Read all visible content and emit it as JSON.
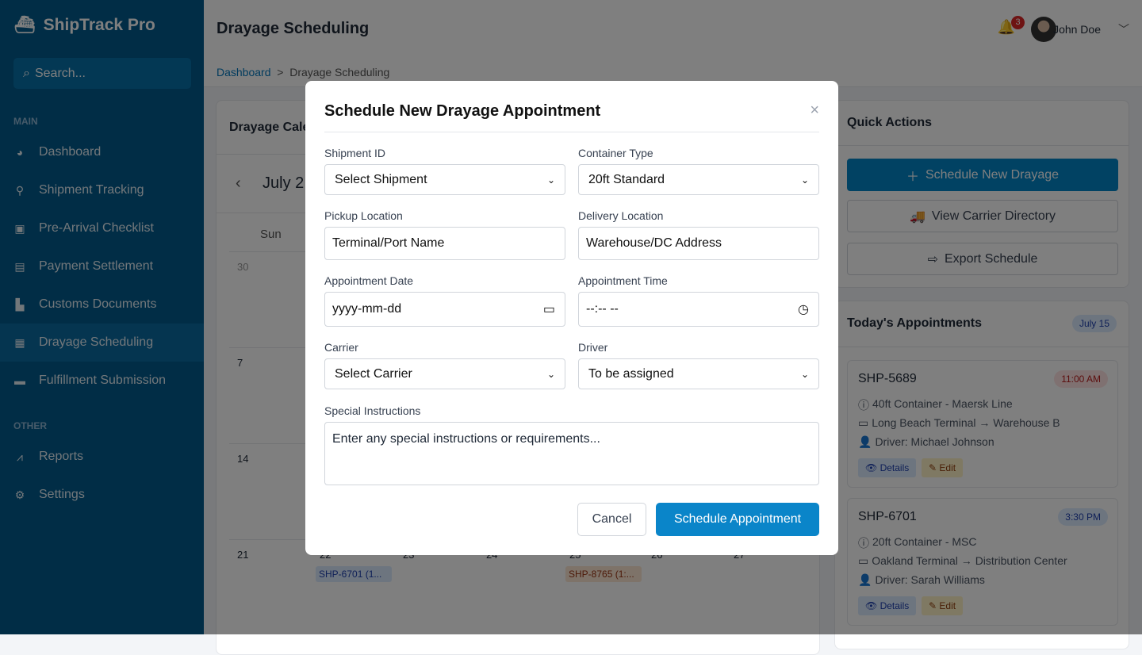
{
  "app": {
    "name": "ShipTrack Pro",
    "search_placeholder": "Search..."
  },
  "sidebar": {
    "sections": [
      {
        "label": "MAIN"
      },
      {
        "label": "OTHER"
      }
    ],
    "items": [
      {
        "label": "Dashboard",
        "icon": "gauge-icon"
      },
      {
        "label": "Shipment Tracking",
        "icon": "route-icon"
      },
      {
        "label": "Pre-Arrival Checklist",
        "icon": "clipboard-check-icon"
      },
      {
        "label": "Payment Settlement",
        "icon": "money-icon"
      },
      {
        "label": "Customs Documents",
        "icon": "file-icon"
      },
      {
        "label": "Drayage Scheduling",
        "icon": "calendar-icon",
        "active": true
      },
      {
        "label": "Fulfillment Submission",
        "icon": "box-icon"
      },
      {
        "label": "Reports",
        "icon": "chart-line-icon"
      },
      {
        "label": "Settings",
        "icon": "gear-icon"
      }
    ]
  },
  "header": {
    "title": "Drayage Scheduling",
    "breadcrumb": [
      "Dashboard",
      "Drayage Scheduling"
    ],
    "notifications": "3",
    "user": "John Doe"
  },
  "calendar": {
    "title": "Drayage Cale",
    "month": "July 2",
    "dow": [
      "Sun"
    ],
    "rows": [
      [
        "30"
      ],
      [
        "7"
      ],
      [
        "14"
      ],
      [
        "21",
        "22",
        "23",
        "24",
        "25",
        "26",
        "27"
      ]
    ],
    "events": [
      {
        "day": "22",
        "label": "SHP-6701 (1...",
        "color": "#dbeafe"
      },
      {
        "day": "25",
        "label": "SHP-8765 (1:...",
        "color": "#fde7d3"
      }
    ]
  },
  "quick_actions": {
    "title": "Quick Actions",
    "buttons": [
      "Schedule New Drayage",
      "View Carrier Directory",
      "Export Schedule"
    ]
  },
  "today": {
    "title": "Today's Appointments",
    "date": "July 15",
    "appointments": [
      {
        "id": "SHP-5689",
        "time": "11:00 AM",
        "container": "40ft Container - Maersk Line",
        "route": "Long Beach Terminal → Warehouse B",
        "driver": "Driver: Michael Johnson"
      },
      {
        "id": "SHP-6701",
        "time": "3:30 PM",
        "container": "20ft Container - MSC",
        "route": "Oakland Terminal → Distribution Center",
        "driver": "Driver: Sarah Williams"
      }
    ],
    "details_label": "Details",
    "edit_label": "Edit"
  },
  "modal": {
    "title": "Schedule New Drayage Appointment",
    "fields": {
      "shipment_id": {
        "label": "Shipment ID",
        "value": "Select Shipment"
      },
      "container_type": {
        "label": "Container Type",
        "value": "20ft Standard"
      },
      "pickup": {
        "label": "Pickup Location",
        "placeholder": "Terminal/Port Name"
      },
      "delivery": {
        "label": "Delivery Location",
        "placeholder": "Warehouse/DC Address"
      },
      "date": {
        "label": "Appointment Date",
        "placeholder": "yyyy-mm-dd"
      },
      "time": {
        "label": "Appointment Time",
        "placeholder": "--:-- --"
      },
      "carrier": {
        "label": "Carrier",
        "value": "Select Carrier"
      },
      "driver": {
        "label": "Driver",
        "value": "To be assigned"
      },
      "instructions": {
        "label": "Special Instructions",
        "placeholder": "Enter any special instructions or requirements..."
      }
    },
    "cancel": "Cancel",
    "submit": "Schedule Appointment"
  }
}
